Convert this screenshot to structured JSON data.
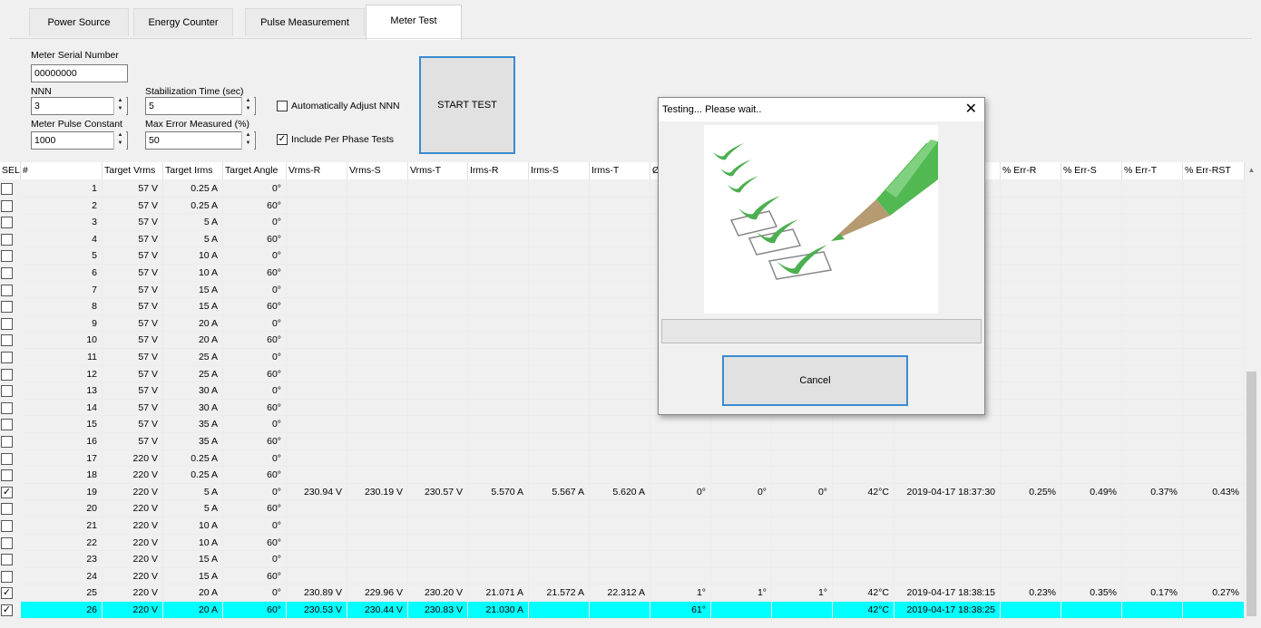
{
  "tabs": [
    "Power Source",
    "Energy Counter",
    "Pulse Measurement",
    "Meter Test"
  ],
  "settings": {
    "serial_label": "Meter Serial Number",
    "serial_value": "00000000",
    "nnn_label": "NNN",
    "nnn_value": "3",
    "pulse_label": "Meter Pulse Constant",
    "pulse_value": "1000",
    "stab_label": "Stabilization Time (sec)",
    "stab_value": "5",
    "maxerr_label": "Max Error Measured (%)",
    "maxerr_value": "50",
    "auto_adjust_label": "Automatically Adjust NNN",
    "auto_adjust_checked": false,
    "per_phase_label": "Include Per Phase Tests",
    "per_phase_checked": true,
    "start_label": "START TEST"
  },
  "table": {
    "headers": [
      "SEL",
      "#",
      "Target Vrms",
      "Target Irms",
      "Target Angle",
      "Vrms-R",
      "Vrms-S",
      "Vrms-T",
      "Irms-R",
      "Irms-S",
      "Irms-T",
      "Ø",
      "",
      "",
      "",
      "",
      "% Err-R",
      "% Err-S",
      "% Err-T",
      "% Err-RST"
    ],
    "rows": [
      {
        "sel": false,
        "cells": [
          "1",
          "57 V",
          "0.25 A",
          "0°",
          "",
          "",
          "",
          "",
          "",
          "",
          "",
          "",
          "",
          "",
          "",
          "",
          "",
          "",
          ""
        ]
      },
      {
        "sel": false,
        "cells": [
          "2",
          "57 V",
          "0.25 A",
          "60°",
          "",
          "",
          "",
          "",
          "",
          "",
          "",
          "",
          "",
          "",
          "",
          "",
          "",
          "",
          ""
        ]
      },
      {
        "sel": false,
        "cells": [
          "3",
          "57 V",
          "5 A",
          "0°",
          "",
          "",
          "",
          "",
          "",
          "",
          "",
          "",
          "",
          "",
          "",
          "",
          "",
          "",
          ""
        ]
      },
      {
        "sel": false,
        "cells": [
          "4",
          "57 V",
          "5 A",
          "60°",
          "",
          "",
          "",
          "",
          "",
          "",
          "",
          "",
          "",
          "",
          "",
          "",
          "",
          "",
          ""
        ]
      },
      {
        "sel": false,
        "cells": [
          "5",
          "57 V",
          "10 A",
          "0°",
          "",
          "",
          "",
          "",
          "",
          "",
          "",
          "",
          "",
          "",
          "",
          "",
          "",
          "",
          ""
        ]
      },
      {
        "sel": false,
        "cells": [
          "6",
          "57 V",
          "10 A",
          "60°",
          "",
          "",
          "",
          "",
          "",
          "",
          "",
          "",
          "",
          "",
          "",
          "",
          "",
          "",
          ""
        ]
      },
      {
        "sel": false,
        "cells": [
          "7",
          "57 V",
          "15 A",
          "0°",
          "",
          "",
          "",
          "",
          "",
          "",
          "",
          "",
          "",
          "",
          "",
          "",
          "",
          "",
          ""
        ]
      },
      {
        "sel": false,
        "cells": [
          "8",
          "57 V",
          "15 A",
          "60°",
          "",
          "",
          "",
          "",
          "",
          "",
          "",
          "",
          "",
          "",
          "",
          "",
          "",
          "",
          ""
        ]
      },
      {
        "sel": false,
        "cells": [
          "9",
          "57 V",
          "20 A",
          "0°",
          "",
          "",
          "",
          "",
          "",
          "",
          "",
          "",
          "",
          "",
          "",
          "",
          "",
          "",
          ""
        ]
      },
      {
        "sel": false,
        "cells": [
          "10",
          "57 V",
          "20 A",
          "60°",
          "",
          "",
          "",
          "",
          "",
          "",
          "",
          "",
          "",
          "",
          "",
          "",
          "",
          "",
          ""
        ]
      },
      {
        "sel": false,
        "cells": [
          "11",
          "57 V",
          "25 A",
          "0°",
          "",
          "",
          "",
          "",
          "",
          "",
          "",
          "",
          "",
          "",
          "",
          "",
          "",
          "",
          ""
        ]
      },
      {
        "sel": false,
        "cells": [
          "12",
          "57 V",
          "25 A",
          "60°",
          "",
          "",
          "",
          "",
          "",
          "",
          "",
          "",
          "",
          "",
          "",
          "",
          "",
          "",
          ""
        ]
      },
      {
        "sel": false,
        "cells": [
          "13",
          "57 V",
          "30 A",
          "0°",
          "",
          "",
          "",
          "",
          "",
          "",
          "",
          "",
          "",
          "",
          "",
          "",
          "",
          "",
          ""
        ]
      },
      {
        "sel": false,
        "cells": [
          "14",
          "57 V",
          "30 A",
          "60°",
          "",
          "",
          "",
          "",
          "",
          "",
          "",
          "",
          "",
          "",
          "",
          "",
          "",
          "",
          ""
        ]
      },
      {
        "sel": false,
        "cells": [
          "15",
          "57 V",
          "35 A",
          "0°",
          "",
          "",
          "",
          "",
          "",
          "",
          "",
          "",
          "",
          "",
          "",
          "",
          "",
          "",
          ""
        ]
      },
      {
        "sel": false,
        "cells": [
          "16",
          "57 V",
          "35 A",
          "60°",
          "",
          "",
          "",
          "",
          "",
          "",
          "",
          "",
          "",
          "",
          "",
          "",
          "",
          "",
          ""
        ]
      },
      {
        "sel": false,
        "cells": [
          "17",
          "220 V",
          "0.25 A",
          "0°",
          "",
          "",
          "",
          "",
          "",
          "",
          "",
          "",
          "",
          "",
          "",
          "",
          "",
          "",
          ""
        ]
      },
      {
        "sel": false,
        "cells": [
          "18",
          "220 V",
          "0.25 A",
          "60°",
          "",
          "",
          "",
          "",
          "",
          "",
          "",
          "",
          "",
          "",
          "",
          "",
          "",
          "",
          ""
        ]
      },
      {
        "sel": true,
        "cells": [
          "19",
          "220 V",
          "5 A",
          "0°",
          "230.94 V",
          "230.19 V",
          "230.57 V",
          "5.570 A",
          "5.567 A",
          "5.620 A",
          "0°",
          "0°",
          "0°",
          "42°C",
          "2019-04-17 18:37:30",
          "0.25%",
          "0.49%",
          "0.37%",
          "0.43%"
        ]
      },
      {
        "sel": false,
        "cells": [
          "20",
          "220 V",
          "5 A",
          "60°",
          "",
          "",
          "",
          "",
          "",
          "",
          "",
          "",
          "",
          "",
          "",
          "",
          "",
          "",
          ""
        ]
      },
      {
        "sel": false,
        "cells": [
          "21",
          "220 V",
          "10 A",
          "0°",
          "",
          "",
          "",
          "",
          "",
          "",
          "",
          "",
          "",
          "",
          "",
          "",
          "",
          "",
          ""
        ]
      },
      {
        "sel": false,
        "cells": [
          "22",
          "220 V",
          "10 A",
          "60°",
          "",
          "",
          "",
          "",
          "",
          "",
          "",
          "",
          "",
          "",
          "",
          "",
          "",
          "",
          ""
        ]
      },
      {
        "sel": false,
        "cells": [
          "23",
          "220 V",
          "15 A",
          "0°",
          "",
          "",
          "",
          "",
          "",
          "",
          "",
          "",
          "",
          "",
          "",
          "",
          "",
          "",
          ""
        ]
      },
      {
        "sel": false,
        "cells": [
          "24",
          "220 V",
          "15 A",
          "60°",
          "",
          "",
          "",
          "",
          "",
          "",
          "",
          "",
          "",
          "",
          "",
          "",
          "",
          "",
          ""
        ]
      },
      {
        "sel": true,
        "cells": [
          "25",
          "220 V",
          "20 A",
          "0°",
          "230.89 V",
          "229.96 V",
          "230.20 V",
          "21.071 A",
          "21.572 A",
          "22.312 A",
          "1°",
          "1°",
          "1°",
          "42°C",
          "2019-04-17 18:38:15",
          "0.23%",
          "0.35%",
          "0.17%",
          "0.27%"
        ]
      },
      {
        "sel": true,
        "current": true,
        "cells": [
          "26",
          "220 V",
          "20 A",
          "60°",
          "230.53 V",
          "230.44 V",
          "230.83 V",
          "21.030 A",
          "",
          "",
          "61°",
          "",
          "",
          "42°C",
          "2019-04-17 18:38:25",
          "",
          "",
          "",
          ""
        ]
      }
    ]
  },
  "dialog": {
    "title": "Testing... Please wait..",
    "close_icon": "close-icon",
    "cancel_label": "Cancel",
    "progress": 0
  },
  "colors": {
    "selected_row": "#00ffff",
    "accent": "#3a8bd0"
  }
}
